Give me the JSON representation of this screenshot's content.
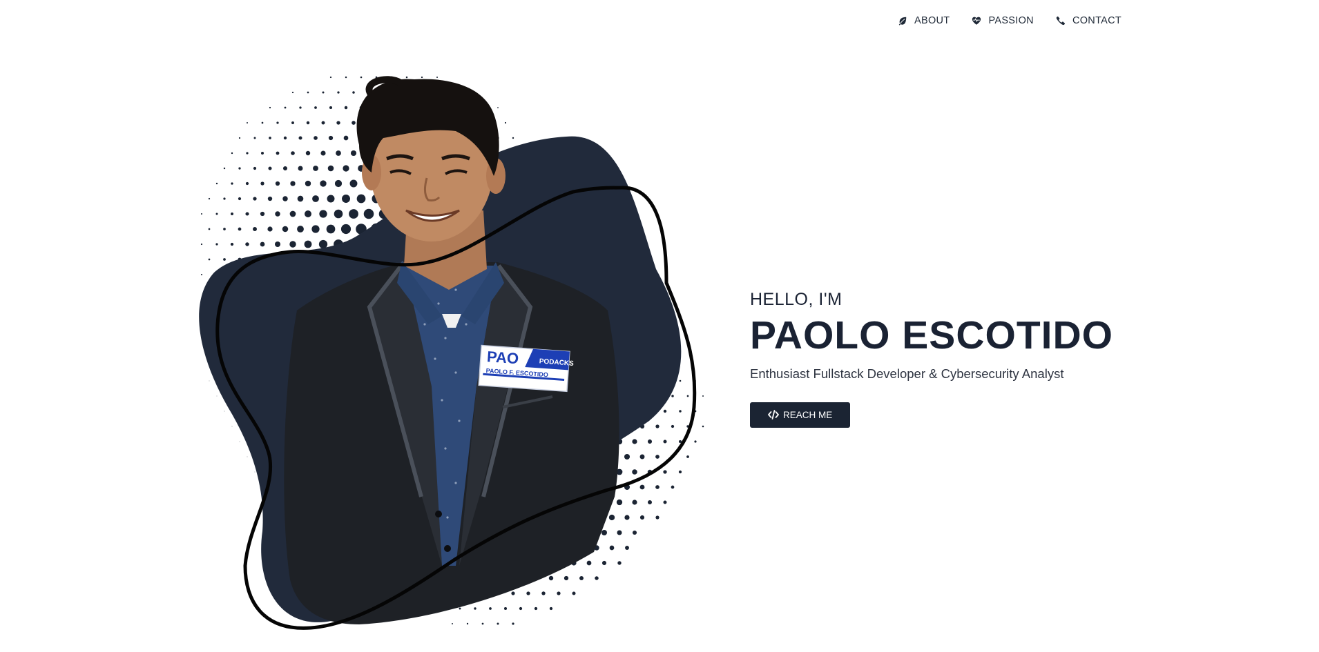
{
  "nav": {
    "items": [
      {
        "label": "ABOUT",
        "icon": "leaf-icon"
      },
      {
        "label": "PASSION",
        "icon": "heart-pulse-icon"
      },
      {
        "label": "CONTACT",
        "icon": "phone-icon"
      }
    ]
  },
  "hero": {
    "greeting": "HELLO, I'M",
    "name": "PAOLO ESCOTIDO",
    "tagline": "Enthusiast Fullstack Developer & Cybersecurity Analyst",
    "cta_label": "REACH ME",
    "cta_icon": "code-icon",
    "badge": {
      "line1": "PAO",
      "corner": "PODACKS",
      "line2": "PAOLO F. ESCOTIDO"
    }
  },
  "colors": {
    "primary": "#1b2433",
    "blob": "#212a3b",
    "text": "#1a2233",
    "background": "#ffffff"
  }
}
